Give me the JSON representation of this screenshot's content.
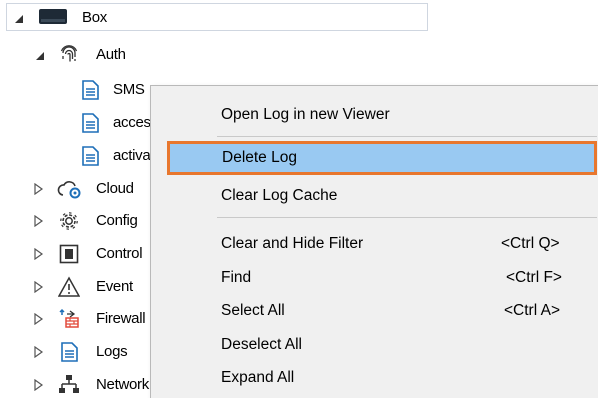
{
  "tree": {
    "root": {
      "label": "Box",
      "expanded": true
    },
    "auth": {
      "label": "Auth",
      "expanded": true
    },
    "logs": [
      "SMS",
      "acces",
      "activa"
    ],
    "groups": [
      {
        "label": "Cloud",
        "icon": "cloud-gear-icon"
      },
      {
        "label": "Config",
        "icon": "gear-icon"
      },
      {
        "label": "Control",
        "icon": "control-panel-icon"
      },
      {
        "label": "Event",
        "icon": "warning-triangle-icon"
      },
      {
        "label": "Firewall",
        "icon": "firewall-icon"
      },
      {
        "label": "Logs",
        "icon": "document-icon"
      },
      {
        "label": "Network",
        "icon": "network-icon"
      }
    ]
  },
  "menu": {
    "items": [
      {
        "label": "Open Log in new Viewer",
        "shortcut": ""
      },
      {
        "label": "Delete Log",
        "shortcut": ""
      },
      {
        "label": "Clear Log Cache",
        "shortcut": ""
      },
      {
        "label": "Clear and Hide Filter",
        "shortcut": "<Ctrl Q>"
      },
      {
        "label": "Find",
        "shortcut": "<Ctrl F>"
      },
      {
        "label": "Select All",
        "shortcut": "<Ctrl A>"
      },
      {
        "label": "Deselect All",
        "shortcut": ""
      },
      {
        "label": "Expand All",
        "shortcut": ""
      }
    ],
    "highlighted_item": "Delete Log"
  },
  "colors": {
    "menu_background": "#f0f0f0",
    "highlight_fill": "#99c9f2",
    "highlight_border": "#e8772e",
    "icon_blue": "#1e6fb8"
  }
}
